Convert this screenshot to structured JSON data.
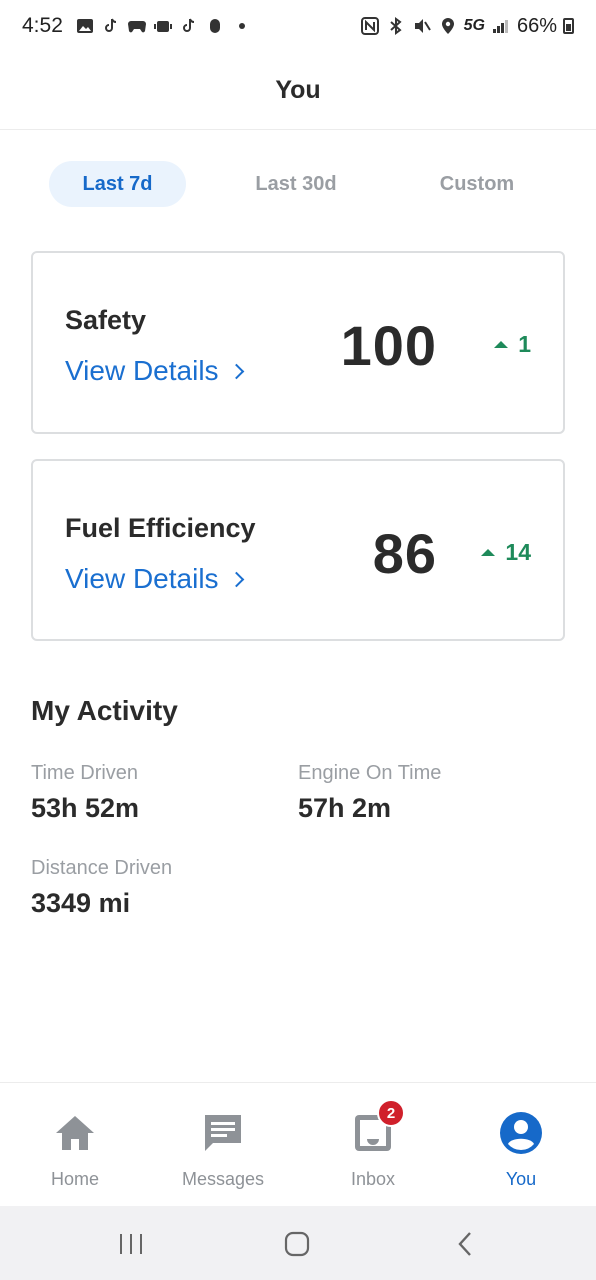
{
  "status_bar": {
    "time": "4:52",
    "network": "5G",
    "battery": "66%"
  },
  "header": {
    "title": "You"
  },
  "range_tabs": [
    {
      "label": "Last 7d",
      "active": true
    },
    {
      "label": "Last 30d",
      "active": false
    },
    {
      "label": "Custom",
      "active": false
    }
  ],
  "cards": {
    "safety": {
      "title": "Safety",
      "link": "View Details",
      "score": "100",
      "delta": "1"
    },
    "fuel": {
      "title": "Fuel Efficiency",
      "link": "View Details",
      "score": "86",
      "delta": "14"
    }
  },
  "activity": {
    "title": "My Activity",
    "time_driven": {
      "label": "Time Driven",
      "value": "53h 52m"
    },
    "engine_on": {
      "label": "Engine On Time",
      "value": "57h 2m"
    },
    "distance": {
      "label": "Distance Driven",
      "value": "3349 mi"
    }
  },
  "bottom_nav": {
    "home": "Home",
    "messages": "Messages",
    "inbox": "Inbox",
    "inbox_badge": "2",
    "you": "You"
  },
  "colors": {
    "accent": "#1669c9",
    "positive": "#1e8a5a",
    "badge": "#d0202b"
  }
}
